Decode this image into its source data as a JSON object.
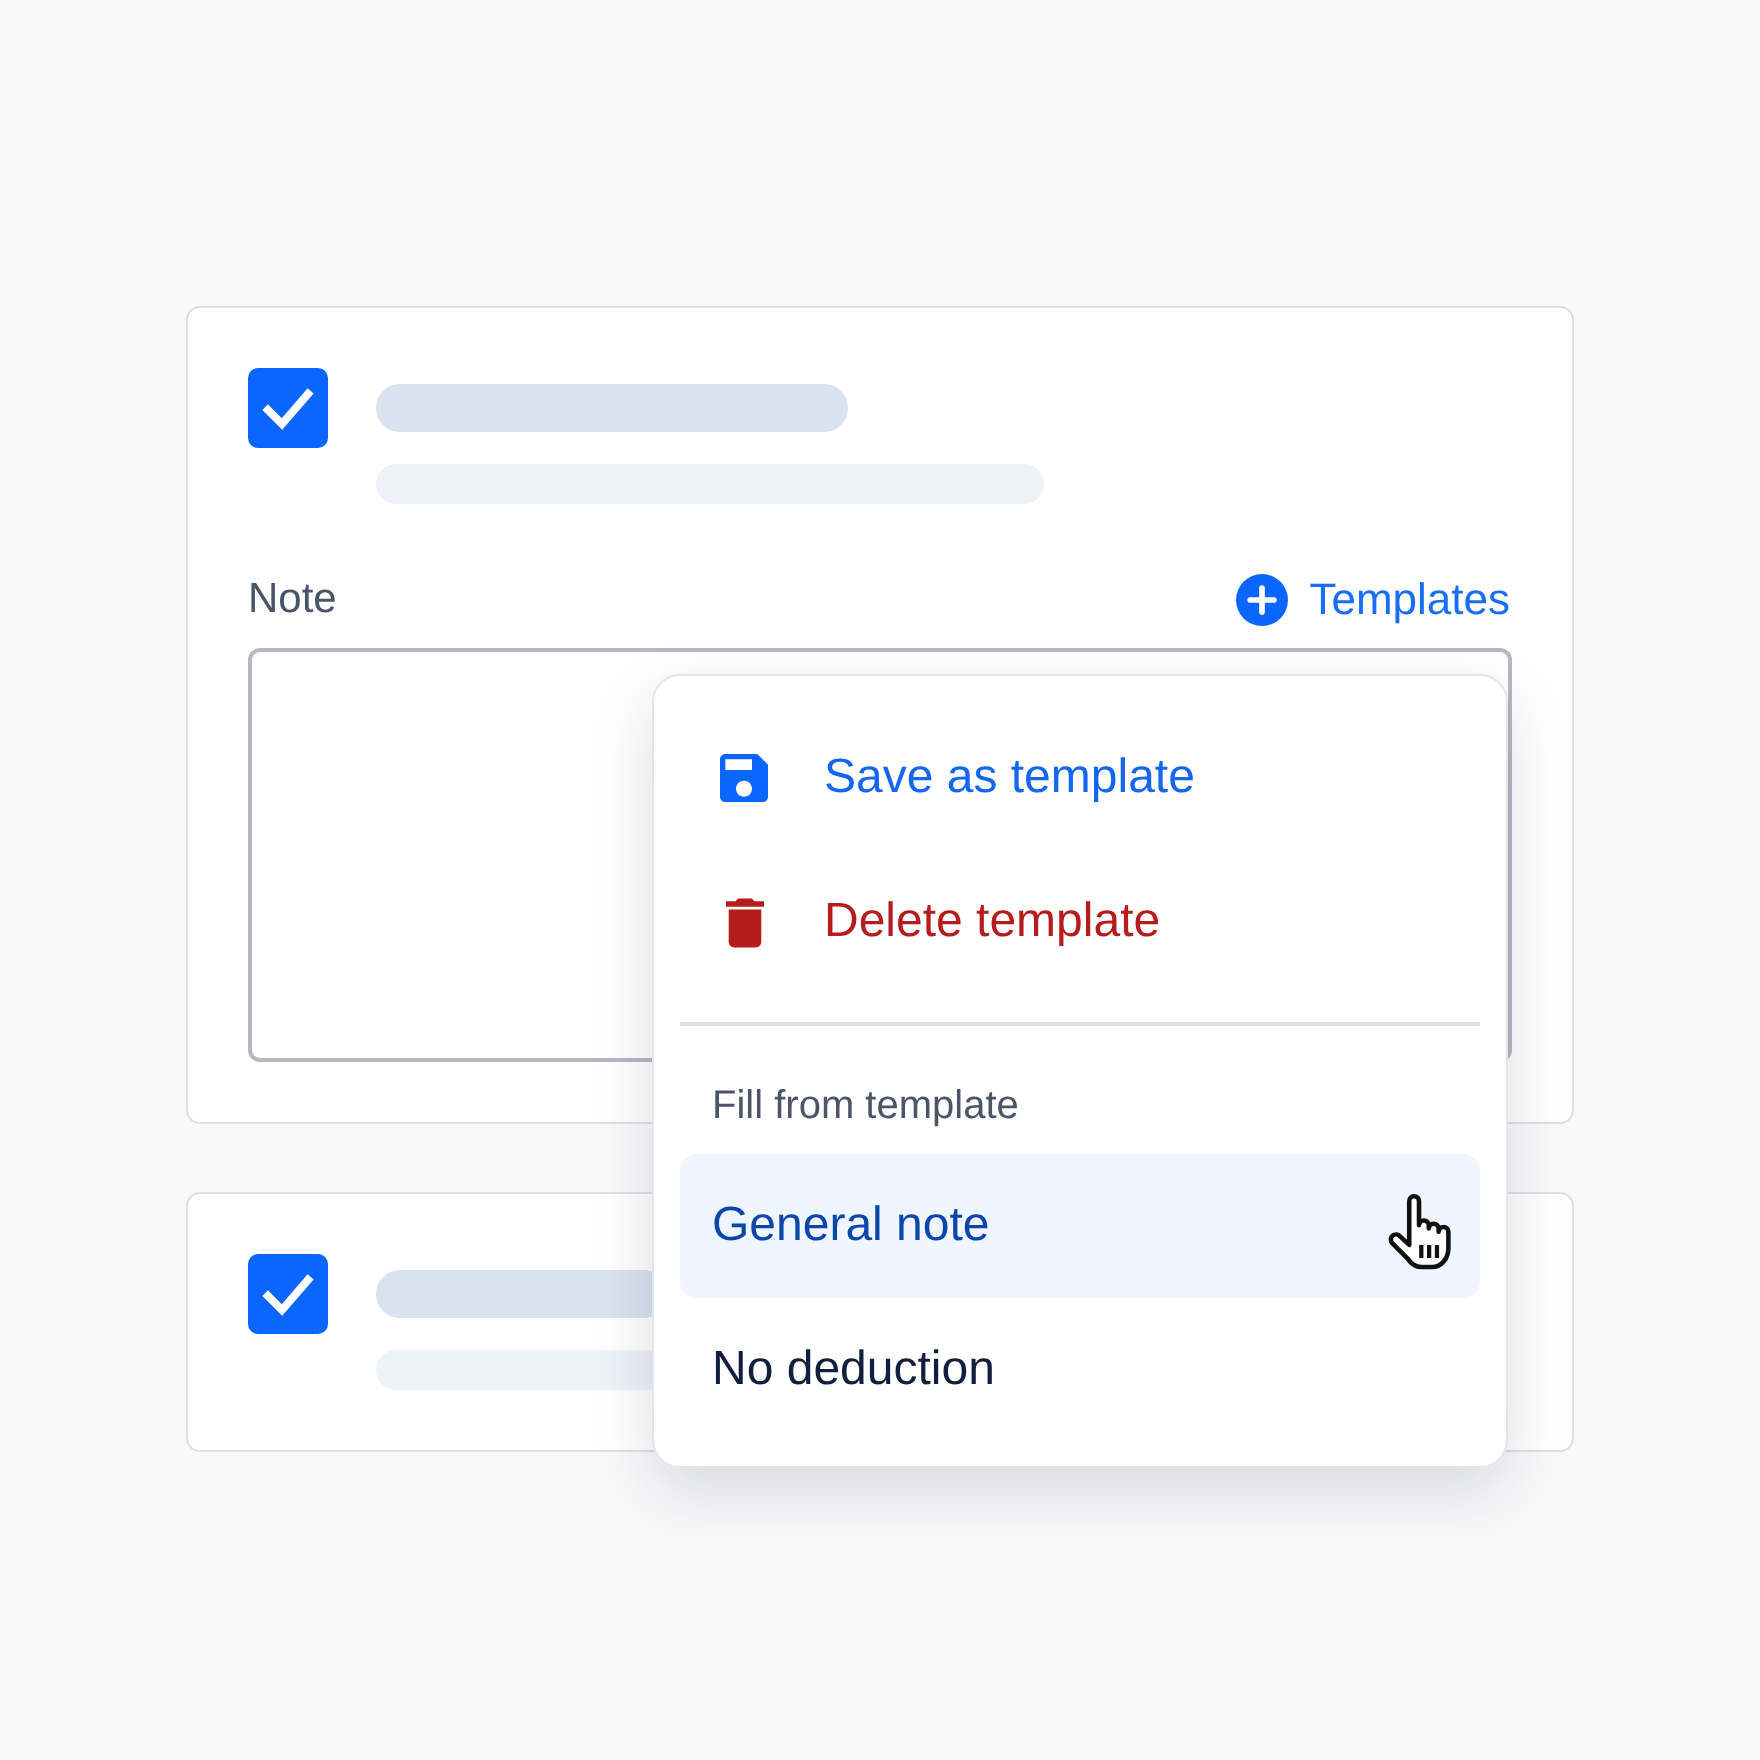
{
  "cards": [
    {
      "checked": true,
      "note": {
        "label": "Note",
        "templates_button": "Templates"
      }
    },
    {
      "checked": true
    }
  ],
  "templates_menu": {
    "actions": [
      {
        "kind": "save",
        "label": "Save as template"
      },
      {
        "kind": "delete",
        "label": "Delete template"
      }
    ],
    "section": {
      "heading": "Fill from template",
      "templates": [
        {
          "label": "General note",
          "hovered": true
        },
        {
          "label": "No deduction",
          "hovered": false
        }
      ]
    }
  }
}
